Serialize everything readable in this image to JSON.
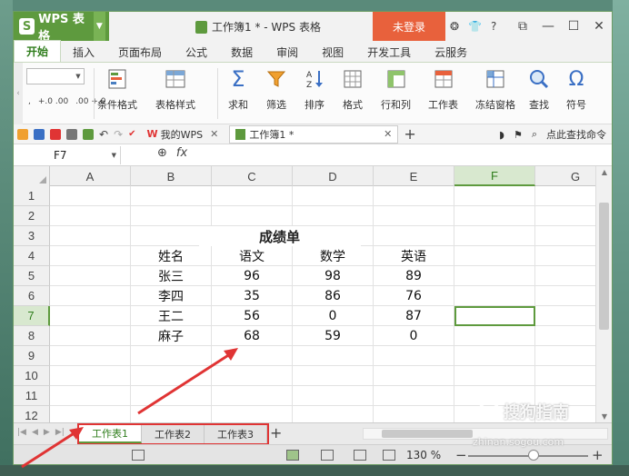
{
  "app": {
    "name": "WPS 表格",
    "logo_letter": "S",
    "window_title": "工作簿1 * - WPS 表格",
    "login_label": "未登录",
    "title_icons": [
      "❂",
      "👕",
      "?"
    ]
  },
  "ribbon_tabs": [
    "开始",
    "插入",
    "页面布局",
    "公式",
    "数据",
    "审阅",
    "视图",
    "开发工具",
    "云服务"
  ],
  "ribbon_groups": [
    {
      "label": "条件格式",
      "icon": "conditional-format-icon"
    },
    {
      "label": "表格样式",
      "icon": "table-style-icon"
    },
    {
      "label": "求和",
      "icon": "sum-icon"
    },
    {
      "label": "筛选",
      "icon": "filter-icon"
    },
    {
      "label": "排序",
      "icon": "sort-icon"
    },
    {
      "label": "格式",
      "icon": "format-icon"
    },
    {
      "label": "行和列",
      "icon": "rows-columns-icon"
    },
    {
      "label": "工作表",
      "icon": "worksheet-icon"
    },
    {
      "label": "冻结窗格",
      "icon": "freeze-panes-icon"
    },
    {
      "label": "查找",
      "icon": "find-icon"
    },
    {
      "label": "符号",
      "icon": "symbol-icon"
    }
  ],
  "ribbon_small": [
    ",",
    "+.0 .00",
    ".00 +.0"
  ],
  "qat": {
    "tabs": [
      {
        "label": "我的WPS",
        "active": false
      },
      {
        "label": "工作簿1 *",
        "active": true
      }
    ],
    "search_label": "点此查找命令"
  },
  "formula_bar": {
    "cell_ref": "F7",
    "fx_label": "fx"
  },
  "sheet": {
    "columns": [
      "A",
      "B",
      "C",
      "D",
      "E",
      "F",
      "G"
    ],
    "selected_column": "F",
    "selected_row": 7,
    "rows": [
      {
        "num": "1",
        "cells": [
          "",
          "",
          "",
          "",
          "",
          "",
          ""
        ]
      },
      {
        "num": "2",
        "cells": [
          "",
          "",
          "",
          "",
          "",
          "",
          ""
        ]
      },
      {
        "num": "3",
        "cells": [
          "",
          "",
          "",
          "",
          "",
          "",
          ""
        ]
      },
      {
        "num": "4",
        "cells": [
          "",
          "姓名",
          "语文",
          "数学",
          "英语",
          "",
          ""
        ]
      },
      {
        "num": "5",
        "cells": [
          "",
          "张三",
          "96",
          "98",
          "89",
          "",
          ""
        ]
      },
      {
        "num": "6",
        "cells": [
          "",
          "李四",
          "35",
          "86",
          "76",
          "",
          ""
        ]
      },
      {
        "num": "7",
        "cells": [
          "",
          "王二",
          "56",
          "0",
          "87",
          "",
          ""
        ]
      },
      {
        "num": "8",
        "cells": [
          "",
          "麻子",
          "68",
          "59",
          "0",
          "",
          ""
        ]
      },
      {
        "num": "9",
        "cells": [
          "",
          "",
          "",
          "",
          "",
          "",
          ""
        ]
      },
      {
        "num": "10",
        "cells": [
          "",
          "",
          "",
          "",
          "",
          "",
          ""
        ]
      },
      {
        "num": "11",
        "cells": [
          "",
          "",
          "",
          "",
          "",
          "",
          ""
        ]
      },
      {
        "num": "12",
        "cells": [
          "",
          "",
          "",
          "",
          "",
          "",
          ""
        ]
      }
    ],
    "merged_title": "成绩单"
  },
  "sheet_tabs": [
    {
      "label": "工作表1",
      "active": true
    },
    {
      "label": "工作表2",
      "active": false
    },
    {
      "label": "工作表3",
      "active": false
    }
  ],
  "status": {
    "zoom": "130 %",
    "zoom_minus": "−",
    "zoom_plus": "+"
  },
  "watermark": {
    "text": "搜狗指南",
    "sub": "zhinan.sogou.com"
  },
  "colors": {
    "accent": "#5e9a3e",
    "login": "#e8613c",
    "annotation": "#e03434"
  }
}
